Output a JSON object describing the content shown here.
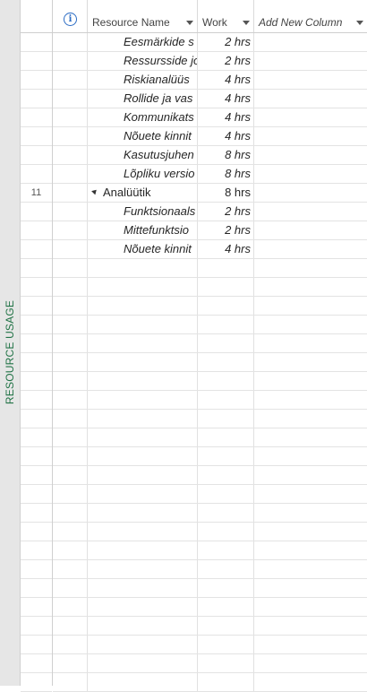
{
  "view_label": "RESOURCE USAGE",
  "columns": {
    "name": "Resource Name",
    "work": "Work",
    "add_new": "Add New Column"
  },
  "rows": [
    {
      "id": "",
      "name": "Eesmärkide s",
      "work": "2 hrs",
      "level": "sub"
    },
    {
      "id": "",
      "name": "Ressursside jo",
      "work": "2 hrs",
      "level": "sub"
    },
    {
      "id": "",
      "name": "Riskianalüüs",
      "work": "4 hrs",
      "level": "sub"
    },
    {
      "id": "",
      "name": "Rollide ja vas",
      "work": "4 hrs",
      "level": "sub"
    },
    {
      "id": "",
      "name": "Kommunikats",
      "work": "4 hrs",
      "level": "sub"
    },
    {
      "id": "",
      "name": "Nõuete kinnit",
      "work": "4 hrs",
      "level": "sub"
    },
    {
      "id": "",
      "name": "Kasutusjuhen",
      "work": "8 hrs",
      "level": "sub"
    },
    {
      "id": "",
      "name": "Lõpliku versio",
      "work": "8 hrs",
      "level": "sub"
    },
    {
      "id": "11",
      "name": "Analüütik",
      "work": "8 hrs",
      "level": "parent"
    },
    {
      "id": "",
      "name": "Funktsionaals",
      "work": "2 hrs",
      "level": "sub"
    },
    {
      "id": "",
      "name": "Mittefunktsio",
      "work": "2 hrs",
      "level": "sub"
    },
    {
      "id": "",
      "name": "Nõuete kinnit",
      "work": "4 hrs",
      "level": "sub"
    }
  ],
  "empty_row_count": 23
}
